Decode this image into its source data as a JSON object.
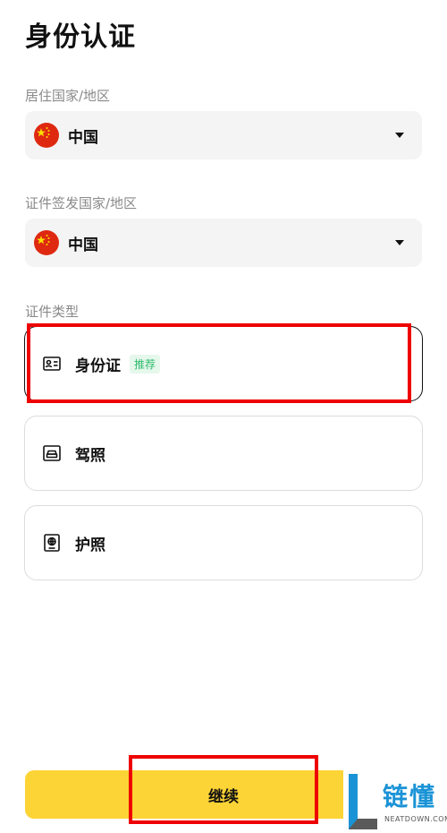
{
  "page": {
    "title": "身份认证"
  },
  "residence": {
    "label": "居住国家/地区",
    "value": "中国"
  },
  "issuing_country": {
    "label": "证件签发国家/地区",
    "value": "中国"
  },
  "doc_type": {
    "label": "证件类型",
    "options": [
      {
        "label": "身份证",
        "badge": "推荐",
        "icon": "id-card-icon"
      },
      {
        "label": "驾照",
        "icon": "car-icon"
      },
      {
        "label": "护照",
        "icon": "passport-icon"
      }
    ]
  },
  "actions": {
    "continue_label": "继续"
  },
  "watermark": {
    "title": "链懂",
    "subtitle": "NEATDOWN.COM"
  },
  "colors": {
    "accent_yellow": "#fdd435",
    "badge_green": "#2dbb6a",
    "highlight_red": "#ee0000"
  }
}
